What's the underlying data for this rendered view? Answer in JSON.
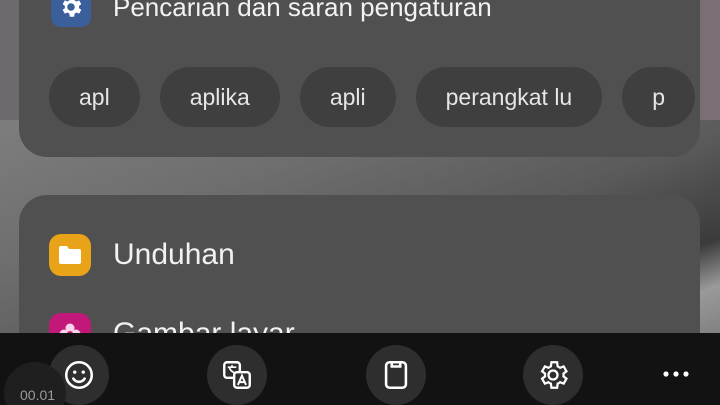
{
  "settings_card": {
    "title": "Pencarian dan saran pengaturan",
    "icon": "gear-icon",
    "icon_bg": "#3b5f9a",
    "chips": [
      "apl",
      "aplika",
      "apli",
      "perangkat lu",
      "p"
    ]
  },
  "apps_card": {
    "items": [
      {
        "label": "Unduhan",
        "icon": "folder-icon",
        "color": "#e8a318"
      },
      {
        "label": "Gambar layar",
        "icon": "flower-icon",
        "color": "#c2187a"
      }
    ]
  },
  "toolbar": {
    "items": [
      {
        "name": "emoji-button",
        "icon": "smiley-icon"
      },
      {
        "name": "translate-button",
        "icon": "translate-icon"
      },
      {
        "name": "clipboard-button",
        "icon": "clipboard-icon"
      },
      {
        "name": "settings-button",
        "icon": "gear-icon"
      },
      {
        "name": "more-button",
        "icon": "more-horizontal-icon"
      }
    ],
    "timer": "00.01"
  }
}
